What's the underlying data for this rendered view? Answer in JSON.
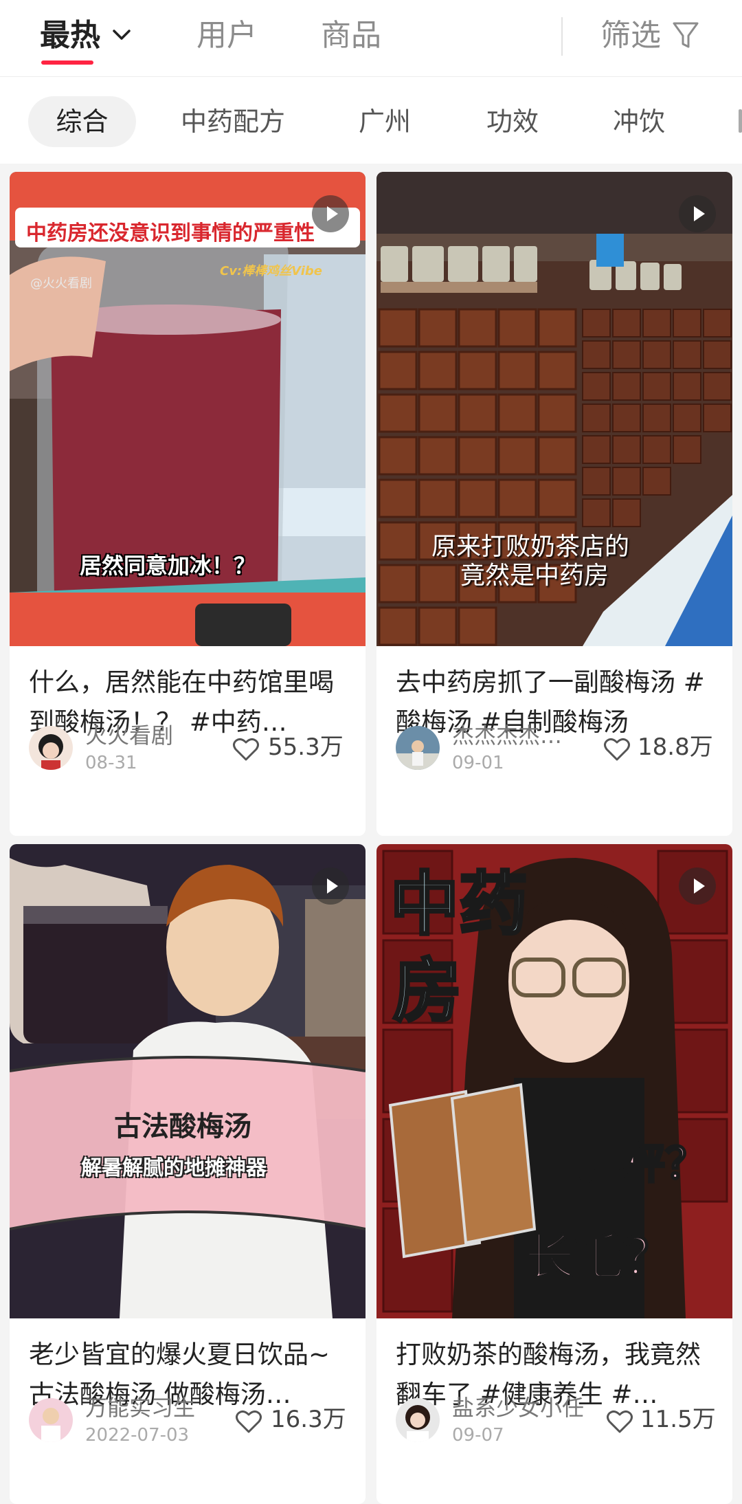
{
  "header": {
    "tabs": [
      {
        "label": "最热"
      },
      {
        "label": "用户"
      },
      {
        "label": "商品"
      }
    ],
    "filter_label": "筛选"
  },
  "chips": [
    "综合",
    "中药配方",
    "广州",
    "功效",
    "冲饮"
  ],
  "accent_color": "#ff2442",
  "cards": [
    {
      "title": "什么，居然能在中药馆里喝到酸梅汤！？ #中药…",
      "author": "火火看剧",
      "date": "08-31",
      "likes": "55.3万",
      "overlay": {
        "banner": "中药房还没意识到事情的严重性",
        "credit": "Cv:棒棒鸡丝Vibe",
        "watermark": "@火火看剧",
        "caption": "居然同意加冰！？"
      }
    },
    {
      "title": "去中药房抓了一副酸梅汤 #酸梅汤 #自制酸梅汤",
      "author": "杰杰杰杰…",
      "date": "09-01",
      "likes": "18.8万",
      "overlay": {
        "caption_1": "原来打败奶茶店的",
        "caption_2": "竟然是中药房"
      }
    },
    {
      "title": "老少皆宜的爆火夏日饮品~古法酸梅汤 做酸梅汤…",
      "author": "万能实习生",
      "date": "2022-07-03",
      "likes": "16.3万",
      "overlay": {
        "caption_1": "古法酸梅汤",
        "caption_2": "解暑解腻的地摊神器"
      }
    },
    {
      "title": "打败奶茶的酸梅汤，我竟然翻车了 #健康养生 #…",
      "author": "盐系少女小任",
      "date": "09-07",
      "likes": "11.5万",
      "overlay": {
        "big_1": "中药",
        "big_2": "房",
        "pink_1": "掉秤？",
        "pink_2": "长毛？"
      }
    }
  ]
}
